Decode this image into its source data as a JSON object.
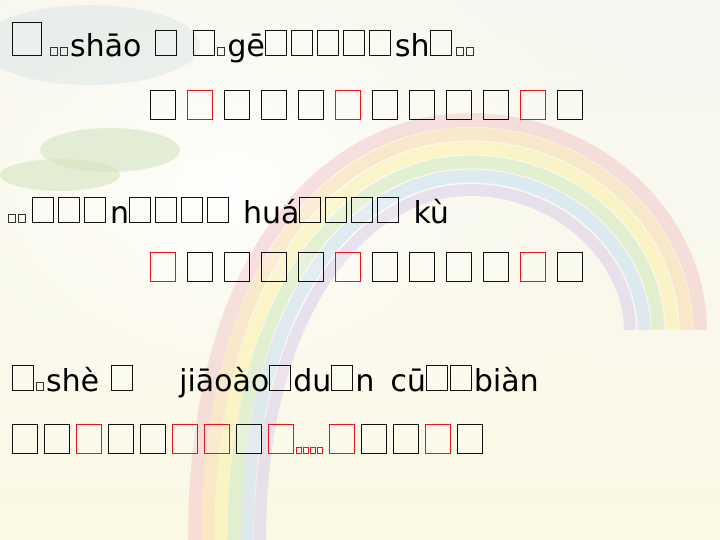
{
  "lines": {
    "l1": {
      "t1": "shāo",
      "t2": "gē",
      "t3": "sh"
    },
    "l3": {
      "t1": "n",
      "t2": "huá",
      "t3": "kù"
    },
    "l5": {
      "t1": "shè",
      "t2": "jiāoào",
      "t3": "du",
      "t4": "n",
      "t5": "cū",
      "t6": "biàn"
    }
  }
}
